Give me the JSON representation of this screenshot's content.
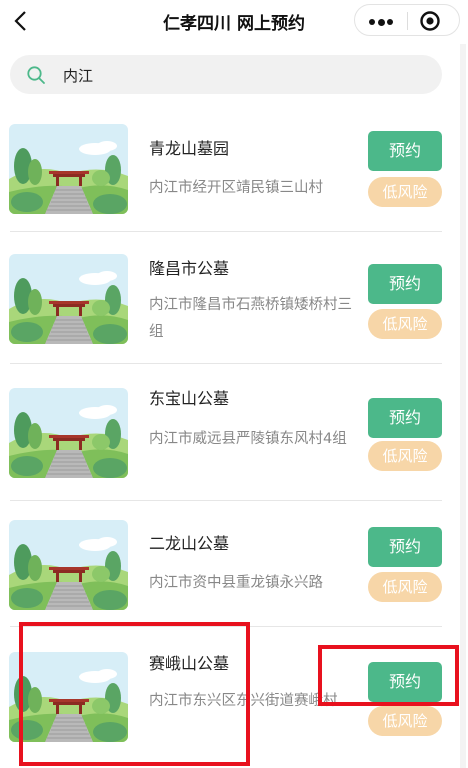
{
  "header": {
    "title": "仁孝四川 网上预约"
  },
  "search": {
    "query": "内江"
  },
  "items": [
    {
      "name": "青龙山墓园",
      "address": "内江市经开区靖民镇三山村",
      "book_label": "预约",
      "risk_label": "低风险"
    },
    {
      "name": "隆昌市公墓",
      "address": "内江市隆昌市石燕桥镇矮桥村三组",
      "book_label": "预约",
      "risk_label": "低风险"
    },
    {
      "name": "东宝山公墓",
      "address": "内江市威远县严陵镇东风村4组",
      "book_label": "预约",
      "risk_label": "低风险"
    },
    {
      "name": "二龙山公墓",
      "address": "内江市资中县重龙镇永兴路",
      "book_label": "预约",
      "risk_label": "低风险"
    },
    {
      "name": "赛峨山公墓",
      "address": "内江市东兴区东兴街道赛峨村",
      "book_label": "预约",
      "risk_label": "低风险"
    }
  ],
  "colors": {
    "accent_green": "#4cb88a",
    "risk_orange": "#f7d6a8",
    "highlight_red": "#e8111e"
  },
  "icons": {
    "back": "chevron-left-icon",
    "more": "more-dots-icon",
    "close": "target-circle-icon",
    "search": "search-icon"
  }
}
